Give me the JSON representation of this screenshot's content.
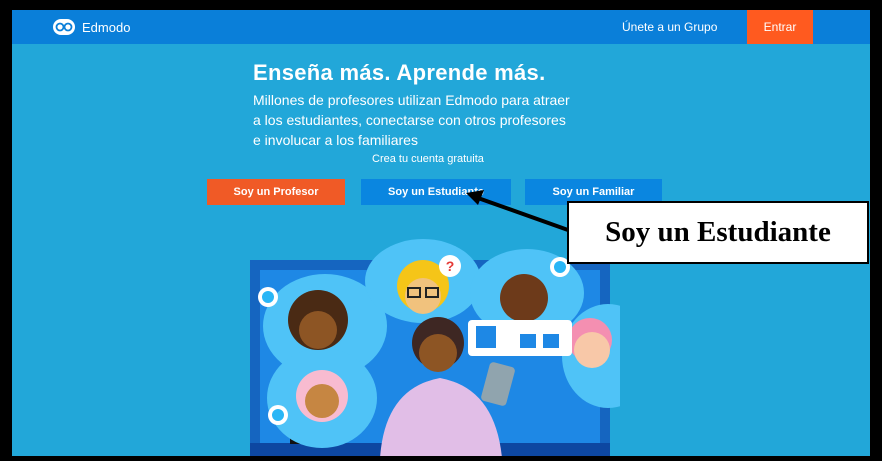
{
  "nav": {
    "brand": "Edmodo",
    "join_group": "Únete a un Grupo",
    "login": "Entrar"
  },
  "hero": {
    "headline": "Enseña más. Aprende más.",
    "line1": "Millones de profesores utilizan Edmodo para atraer",
    "line2": "a los estudiantes, conectarse con otros profesores",
    "line3": "e involucar a los familiares",
    "create_account": "Crea tu cuenta gratuita"
  },
  "buttons": {
    "teacher": "Soy un Profesor",
    "student": "Soy un Estudiante",
    "family": "Soy un Familiar"
  },
  "annotation": {
    "label": "Soy un Estudiante"
  },
  "colors": {
    "page_bg": "#22a7d9",
    "navbar": "#0a7fd9",
    "accent_orange": "#ff5a1f",
    "button_blue": "#0a86e0"
  },
  "icons": [
    "edmodo-logo-icon",
    "question-mark-icon",
    "thumbs-up-icon"
  ]
}
